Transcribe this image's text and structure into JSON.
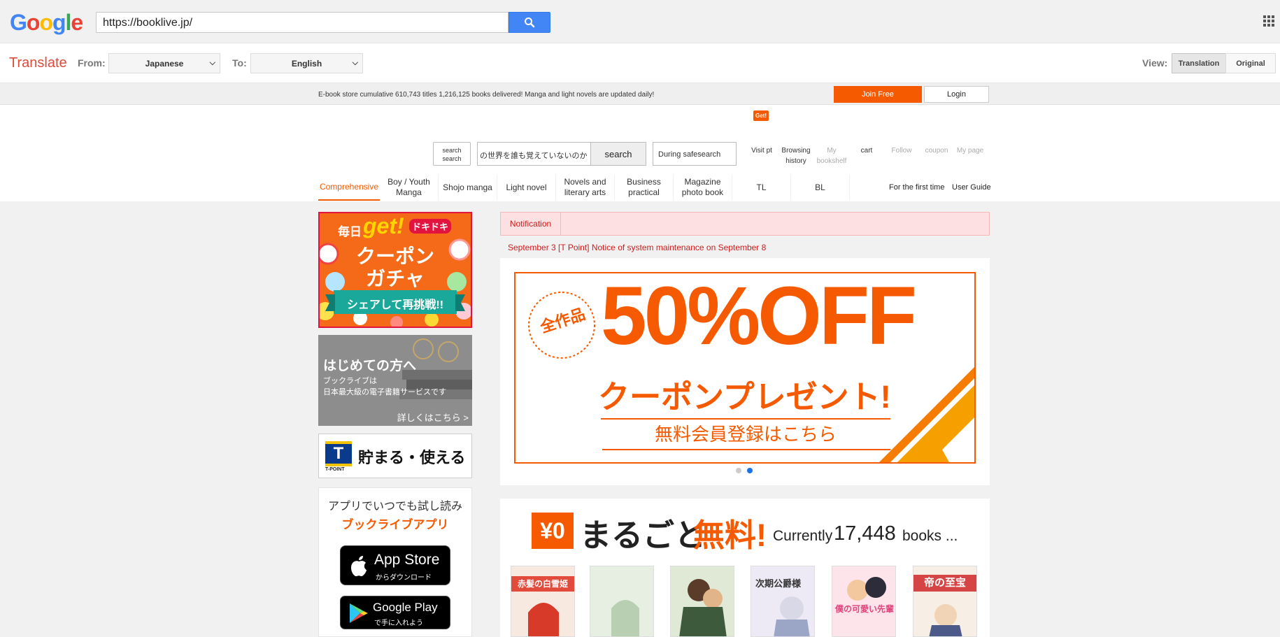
{
  "google": {
    "url": "https://booklive.jp/",
    "search_icon": "search-icon",
    "apps_icon": "apps-grid-icon"
  },
  "translate": {
    "title": "Translate",
    "from_label": "From:",
    "from_value": "Japanese",
    "to_label": "To:",
    "to_value": "English",
    "view_label": "View:",
    "view_translation": "Translation",
    "view_original": "Original"
  },
  "booklive": {
    "strip_text": "E-book store cumulative 610,743 titles 1,216,125 books delivered! Manga and light novels are updated daily!",
    "join_button": "Join Free",
    "login_button": "Login",
    "get_badge": "Get!",
    "search_type": "search search",
    "search_value": "の世界を誰も覚えていないのか",
    "search_button": "search",
    "safesearch": "During safesearch",
    "user_icons": [
      {
        "label": "Visit pt",
        "dim": false
      },
      {
        "label": "Browsing history",
        "dim": false
      },
      {
        "label": "My bookshelf",
        "dim": true
      },
      {
        "label": "cart",
        "dim": false
      },
      {
        "label": "Follow",
        "dim": true
      },
      {
        "label": "coupon",
        "dim": true
      },
      {
        "label": "My page",
        "dim": true
      }
    ],
    "categories": [
      "Comprehensive",
      "Boy / Youth Manga",
      "Shojo manga",
      "Light novel",
      "Novels and literary arts",
      "Business practical",
      "Magazine photo book",
      "TL",
      "BL"
    ],
    "first_time": "For the first time",
    "user_guide": "User Guide"
  },
  "sidebar": {
    "gacha": {
      "daily": "毎日",
      "get": "get!",
      "dokidoki": "ドキドキ",
      "line1": "クーポン",
      "line2": "ガチャ",
      "ribbon": "シェアして再挑戦!!"
    },
    "first": {
      "title": "はじめての方へ",
      "line1": "ブックライブは",
      "line2": "日本最大級の電子書籍サービスです",
      "more": "詳しくはこちら >"
    },
    "tpoint": {
      "logo": "T",
      "logo_sub": "T-POINT",
      "text": "貯まる・使える"
    },
    "app": {
      "line1": "アプリでいつでも試し読み",
      "line2": "ブックライブアプリ",
      "appstore_small": "",
      "appstore_big": "App Store",
      "appstore_sub": "からダウンロード",
      "gplay_big": "Google Play",
      "gplay_sub": "で手に入れよう"
    }
  },
  "main": {
    "notice_label": "Notification",
    "notice_link": "September 3 [T Point] Notice of system maintenance on September 8",
    "hero": {
      "circle": "全作品",
      "big": "50%OFF",
      "line": "クーポンプレゼント!",
      "sub": "無料会員登録はこちら"
    },
    "free": {
      "yen": "¥0",
      "title_a": "まるごと",
      "title_b": "無料!",
      "count_prefix": "Currently",
      "count": "17,448",
      "count_suffix": "books ...",
      "covers": [
        {
          "title": "赤髪の白雪姫",
          "color": "#e24a3b"
        },
        {
          "title": "",
          "color": "#c9dcc4"
        },
        {
          "title": "",
          "color": "#6d8a5a"
        },
        {
          "title": "次期公爵様",
          "color": "#b9c3da"
        },
        {
          "title": "僕の可愛い先輩",
          "color": "#f4b7c3"
        },
        {
          "title": "帝の至宝",
          "color": "#d64545"
        }
      ]
    }
  },
  "colors": {
    "accent": "#f55a00",
    "google_blue": "#4285f4",
    "translate_red": "#dd4b39"
  }
}
